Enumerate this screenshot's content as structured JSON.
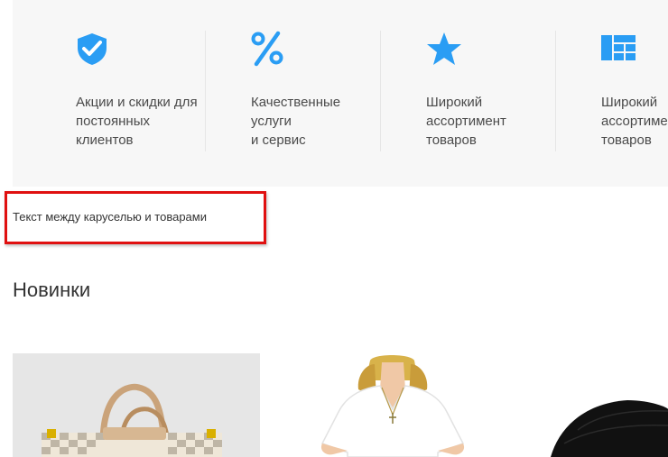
{
  "features": [
    {
      "icon": "shield-check-icon",
      "text": "Акции и скидки для\nпостоянных\nклиентов"
    },
    {
      "icon": "percent-icon",
      "text": "Качественные\nуслуги\nи сервис"
    },
    {
      "icon": "star-icon",
      "text": "Широкий\nассортимент\nтоваров"
    },
    {
      "icon": "grid-layout-icon",
      "text": "Широкий\nассортимент\nтоваров"
    }
  ],
  "between_text": "Текст между каруселью и товарами",
  "section_title": "Новинки",
  "products": [
    {
      "image": "handbag-image"
    },
    {
      "image": "white-tshirt-image"
    },
    {
      "image": "black-cap-image"
    }
  ],
  "colors": {
    "accent": "#2a9df4",
    "highlight": "#e01010",
    "panel": "#f7f7f7"
  }
}
